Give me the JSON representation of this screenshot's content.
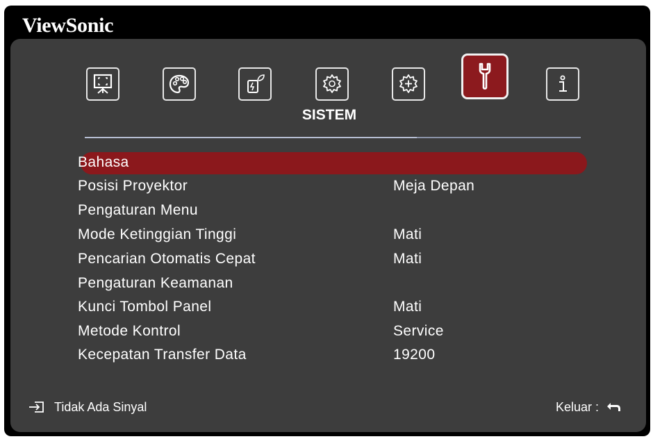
{
  "brand": "ViewSonic",
  "tabs": [
    {
      "name": "display-icon",
      "active": false
    },
    {
      "name": "image-palette-icon",
      "active": false
    },
    {
      "name": "power-eco-icon",
      "active": false
    },
    {
      "name": "basic-settings-gear-icon",
      "active": false
    },
    {
      "name": "advanced-gear-plus-icon",
      "active": false
    },
    {
      "name": "wrench-system-icon",
      "active": true
    },
    {
      "name": "info-icon",
      "active": false
    }
  ],
  "active_tab_title": "SISTEM",
  "menu": [
    {
      "label": "Bahasa",
      "value": "",
      "selected": true
    },
    {
      "label": "Posisi Proyektor",
      "value": "Meja Depan",
      "selected": false
    },
    {
      "label": "Pengaturan Menu",
      "value": "",
      "selected": false
    },
    {
      "label": "Mode Ketinggian Tinggi",
      "value": "Mati",
      "selected": false
    },
    {
      "label": "Pencarian Otomatis Cepat",
      "value": "Mati",
      "selected": false
    },
    {
      "label": "Pengaturan Keamanan",
      "value": "",
      "selected": false
    },
    {
      "label": "Kunci Tombol Panel",
      "value": "Mati",
      "selected": false
    },
    {
      "label": "Metode Kontrol",
      "value": "Service",
      "selected": false
    },
    {
      "label": "Kecepatan Transfer Data",
      "value": "19200",
      "selected": false
    }
  ],
  "footer": {
    "source_icon": "input-source-icon",
    "source_text": "Tidak Ada Sinyal",
    "exit_label": "Keluar :",
    "exit_icon": "return-arrow-icon"
  },
  "colors": {
    "accent": "#8c1a1e",
    "panel": "#3d3d3d",
    "frame": "#000000",
    "text": "#ffffff"
  }
}
